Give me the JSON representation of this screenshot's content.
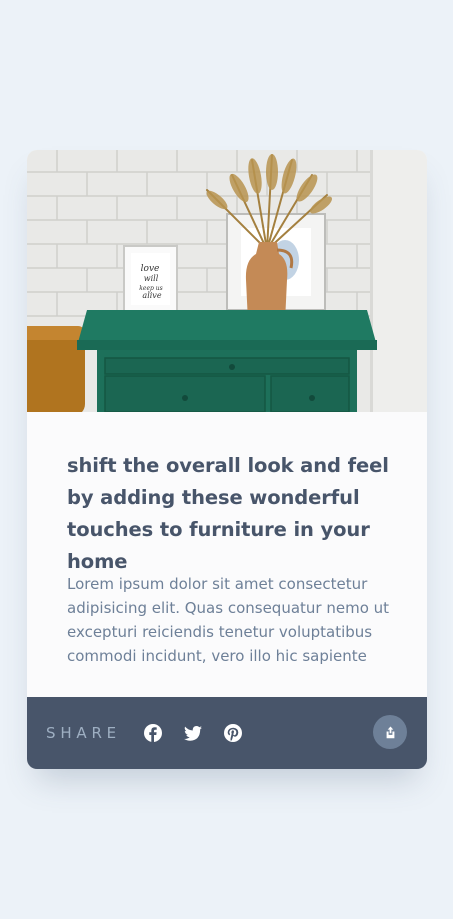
{
  "card": {
    "image": {
      "alt": "Green drawer with picture frames and a vase of dried flowers"
    },
    "title": "shift the overall look and feel by adding these wonderful touches to furniture in your home",
    "description": "Lorem ipsum dolor sit amet consectetur adipisicing elit. Quas consequatur nemo ut excepturi reiciendis tenetur voluptatibus commodi incidunt, vero illo hic sapiente"
  },
  "share": {
    "label": "SHARE",
    "icons": [
      "facebook-icon",
      "twitter-icon",
      "pinterest-icon",
      "share-icon"
    ]
  },
  "colors": {
    "page_background": "#ecf2f8",
    "title": "#48556a",
    "body_text": "#6e8098",
    "share_bar": "#48556a",
    "share_label": "#9eafc2",
    "share_button": "#6e8098"
  }
}
